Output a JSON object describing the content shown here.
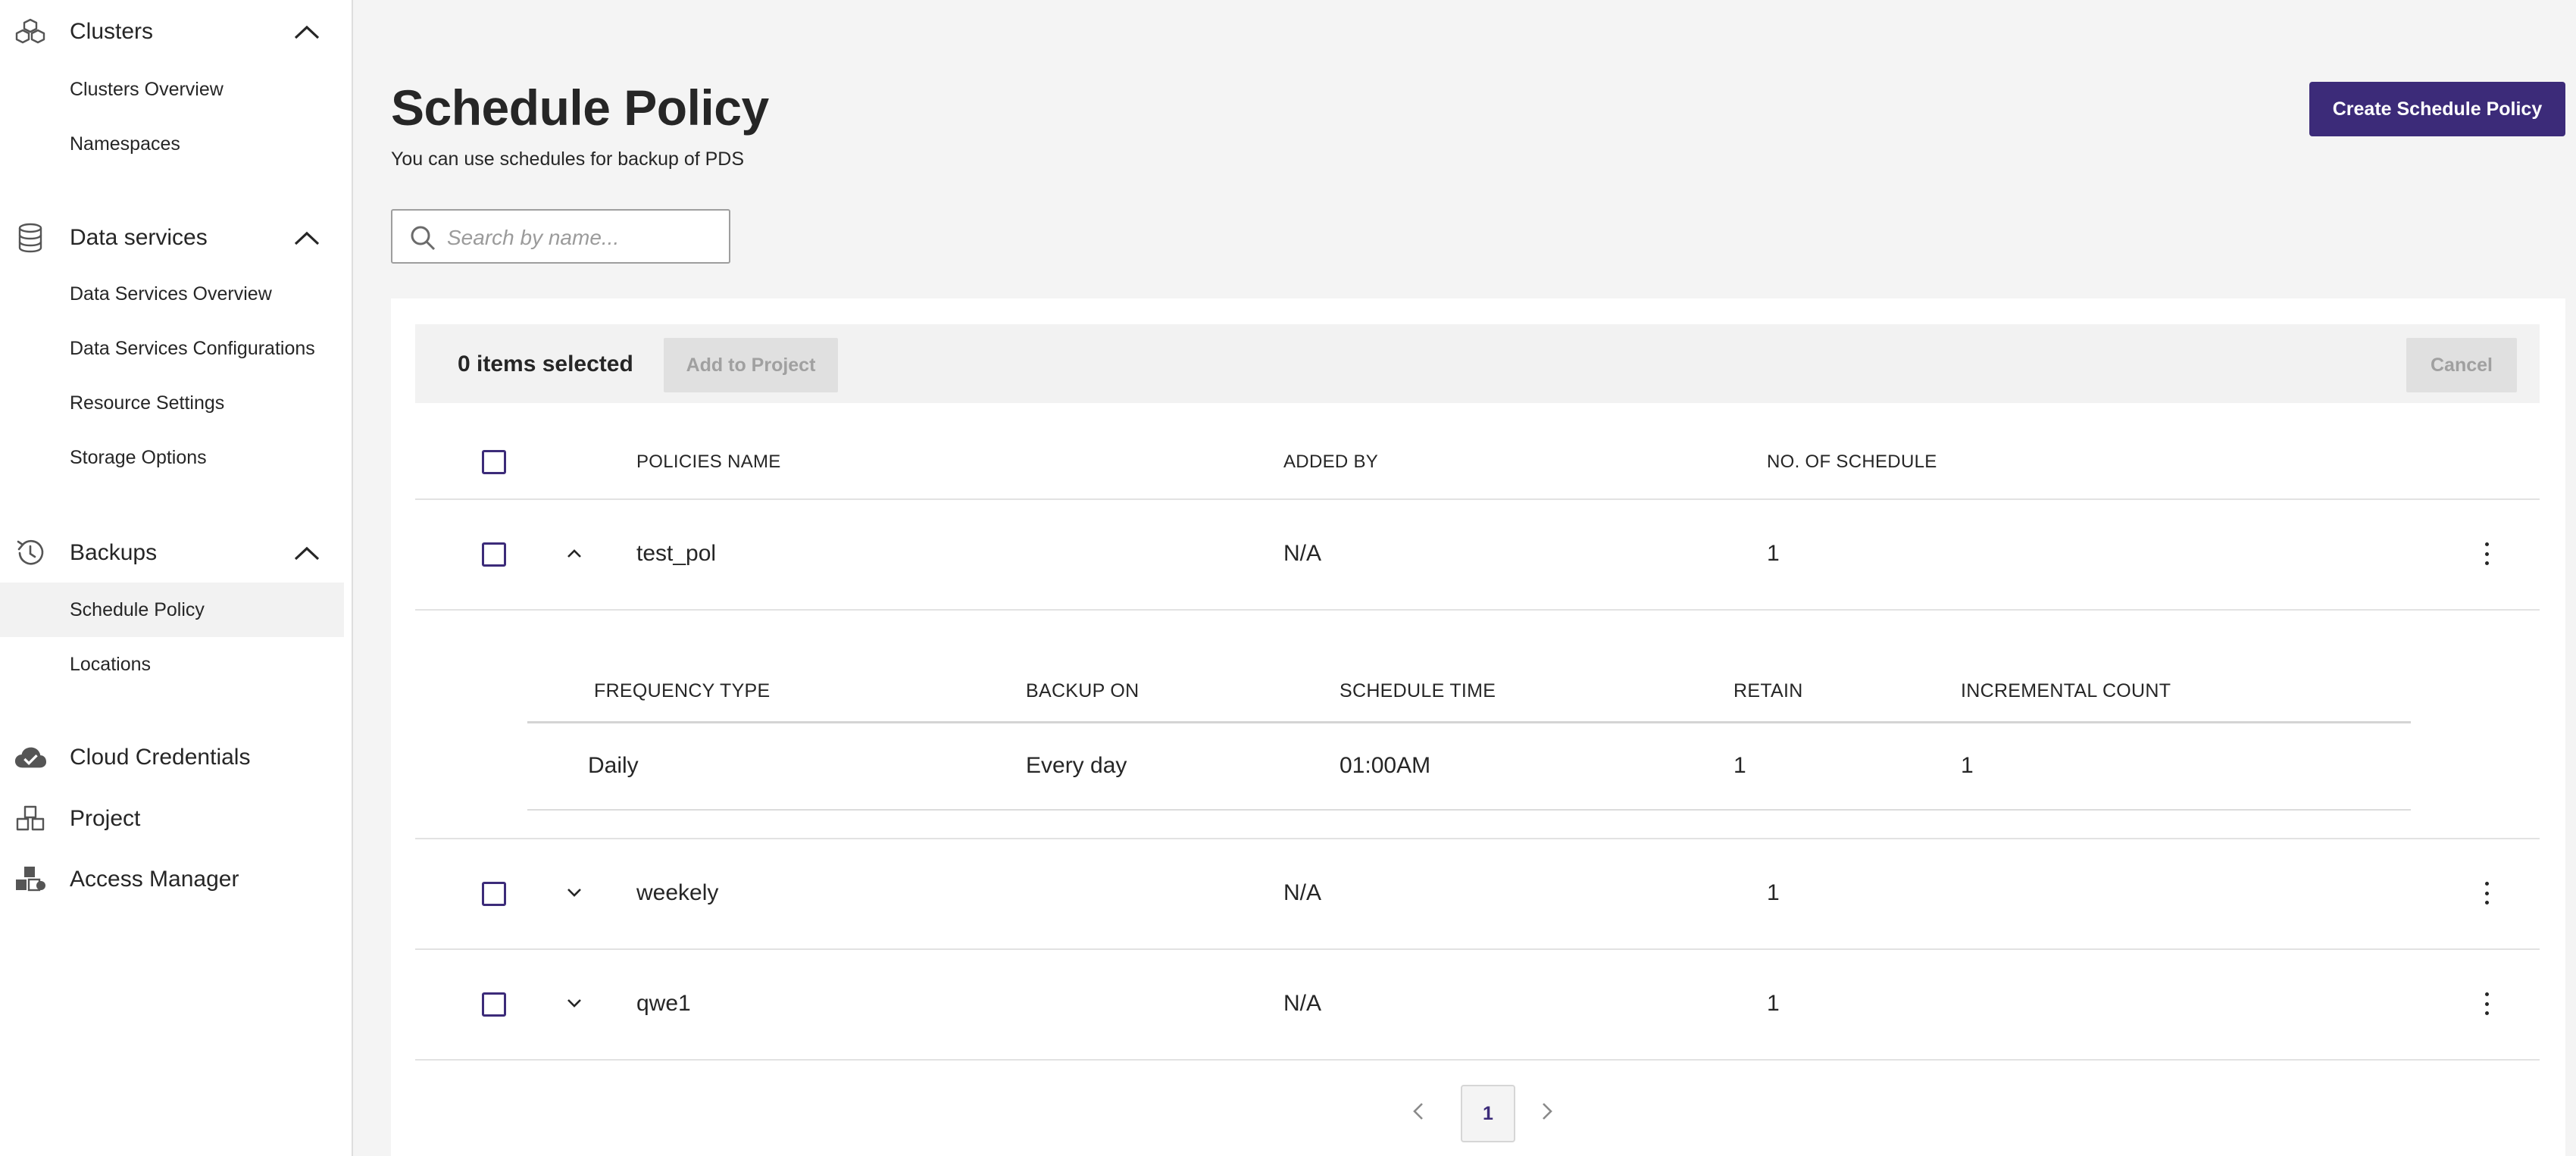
{
  "sidebar": {
    "groups": [
      {
        "label": "Clusters",
        "icon": "clusters-icon",
        "expanded": true,
        "items": [
          "Clusters Overview",
          "Namespaces"
        ]
      },
      {
        "label": "Data services",
        "icon": "database-icon",
        "expanded": true,
        "items": [
          "Data Services Overview",
          "Data Services Configurations",
          "Resource Settings",
          "Storage Options"
        ]
      },
      {
        "label": "Backups",
        "icon": "history-icon",
        "expanded": true,
        "items": [
          "Schedule Policy",
          "Locations"
        ]
      },
      {
        "label": "Cloud Credentials",
        "icon": "cloud-check-icon"
      },
      {
        "label": "Project",
        "icon": "project-cubes-icon"
      },
      {
        "label": "Access Manager",
        "icon": "access-manager-icon"
      }
    ],
    "active_item": "Schedule Policy"
  },
  "header": {
    "title": "Schedule Policy",
    "subtitle": "You can use schedules for backup of PDS",
    "create_button": "Create Schedule Policy"
  },
  "search": {
    "placeholder": "Search by name...",
    "value": ""
  },
  "selection_bar": {
    "count_text": "0 items selected",
    "add_to_project": "Add to Project",
    "cancel": "Cancel"
  },
  "table": {
    "columns": [
      "POLICIES NAME",
      "ADDED BY",
      "NO. OF SCHEDULE"
    ],
    "rows": [
      {
        "name": "test_pol",
        "added_by": "N/A",
        "schedules": "1",
        "expanded": true
      },
      {
        "name": "weekely",
        "added_by": "N/A",
        "schedules": "1",
        "expanded": false
      },
      {
        "name": "qwe1",
        "added_by": "N/A",
        "schedules": "1",
        "expanded": false
      }
    ],
    "detail": {
      "columns": [
        "FREQUENCY TYPE",
        "BACKUP ON",
        "SCHEDULE TIME",
        "RETAIN",
        "INCREMENTAL COUNT"
      ],
      "rows": [
        {
          "frequency": "Daily",
          "backup_on": "Every day",
          "time": "01:00AM",
          "retain": "1",
          "incremental": "1"
        }
      ]
    }
  },
  "pagination": {
    "current_page": "1"
  },
  "colors": {
    "primary": "#3c2b79",
    "background": "#f4f4f4",
    "sidebar_active": "#f2f2f2"
  }
}
